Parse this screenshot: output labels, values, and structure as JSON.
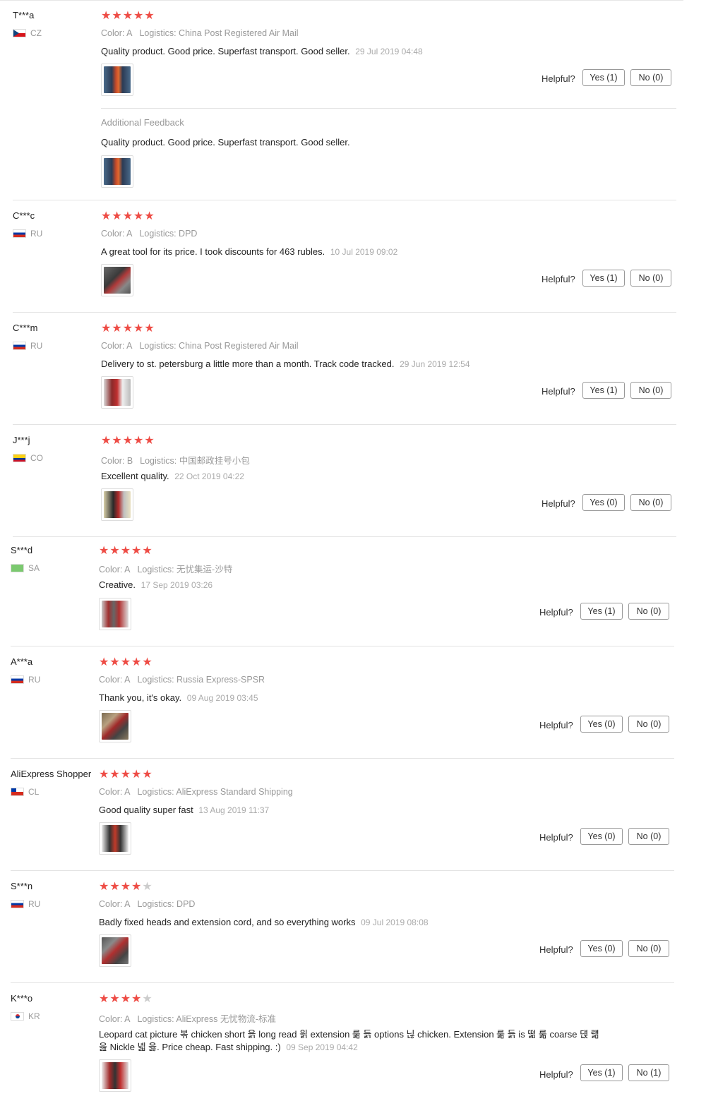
{
  "helpful_label": "Helpful?",
  "reviews": [
    {
      "user": "T***a",
      "country": "CZ",
      "flag_colors": [
        "#ffffff",
        "#d7141a",
        "#11457e"
      ],
      "stars": 5,
      "color": "Color: A",
      "logistics": "Logistics: China Post Registered Air Mail",
      "text": "Quality product. Good price. Superfast transport. Good seller.",
      "date": "29 Jul 2019 04:48",
      "yes": "Yes (1)",
      "no": "No (0)",
      "additional_label": "Additional Feedback",
      "additional_text": "Quality product. Good price. Superfast transport. Good seller."
    },
    {
      "user": "C***c",
      "country": "RU",
      "flag_colors": [
        "#ffffff",
        "#0039a6",
        "#d52b1e"
      ],
      "stars": 5,
      "color": "Color: A",
      "logistics": "Logistics: DPD",
      "text": "A great tool for its price. I took discounts for 463 rubles.",
      "date": "10 Jul 2019 09:02",
      "yes": "Yes (1)",
      "no": "No (0)"
    },
    {
      "user": "C***m",
      "country": "RU",
      "flag_colors": [
        "#ffffff",
        "#0039a6",
        "#d52b1e"
      ],
      "stars": 5,
      "color": "Color: A",
      "logistics": "Logistics: China Post Registered Air Mail",
      "text": "Delivery to st. petersburg a little more than a month. Track code tracked.",
      "date": "29 Jun 2019 12:54",
      "yes": "Yes (1)",
      "no": "No (0)"
    },
    {
      "user": "J***j",
      "country": "CO",
      "flag_colors": [
        "#fcd116",
        "#003893",
        "#ce1126"
      ],
      "stars": 5,
      "color": "Color: B",
      "logistics": "Logistics: 中国邮政挂号小包",
      "text": "Excellent quality.",
      "date": "22 Oct 2019 04:22",
      "yes": "Yes (0)",
      "no": "No (0)"
    },
    {
      "user": "S***d",
      "country": "SA",
      "flag_colors": [
        "#7bc96f",
        "#7bc96f",
        "#7bc96f"
      ],
      "stars": 5,
      "color": "Color: A",
      "logistics": "Logistics: 无忧集运-沙特",
      "text": "Creative.",
      "date": "17 Sep 2019 03:26",
      "yes": "Yes (1)",
      "no": "No (0)"
    },
    {
      "user": "A***a",
      "country": "RU",
      "flag_colors": [
        "#ffffff",
        "#0039a6",
        "#d52b1e"
      ],
      "stars": 5,
      "color": "Color: A",
      "logistics": "Logistics: Russia Express-SPSR",
      "text": "Thank you, it's okay.",
      "date": "09 Aug 2019 03:45",
      "yes": "Yes (0)",
      "no": "No (0)"
    },
    {
      "user": "AliExpress Shopper",
      "country": "CL",
      "flag_colors": [
        "#ffffff",
        "#d52b1e",
        "#d52b1e"
      ],
      "stars": 5,
      "color": "Color: A",
      "logistics": "Logistics: AliExpress Standard Shipping",
      "text": "Good quality super fast",
      "date": "13 Aug 2019 11:37",
      "yes": "Yes (0)",
      "no": "No (0)"
    },
    {
      "user": "S***n",
      "country": "RU",
      "flag_colors": [
        "#ffffff",
        "#0039a6",
        "#d52b1e"
      ],
      "stars": 4,
      "color": "Color: A",
      "logistics": "Logistics: DPD",
      "text": "Badly fixed heads and extension cord, and so everything works",
      "date": "09 Jul 2019 08:08",
      "yes": "Yes (0)",
      "no": "No (0)"
    },
    {
      "user": "K***o",
      "country": "KR",
      "flag_colors": [
        "#ffffff",
        "#ffffff",
        "#ffffff"
      ],
      "stars": 4,
      "color": "Color: A",
      "logistics": "Logistics: AliExpress 无忧物流-标准",
      "text": "Leopard cat picture 볶 chicken short 읅 long read 읡 extension 룲 듥 options 닎 chicken. Extension 룲 듥 is 떪 룲 coarse 댽 럚 읊 Nickle 녧 읋. Price cheap. Fast shipping. :)",
      "date": "09 Sep 2019 04:42",
      "yes": "Yes (1)",
      "no": "No (1)"
    }
  ]
}
